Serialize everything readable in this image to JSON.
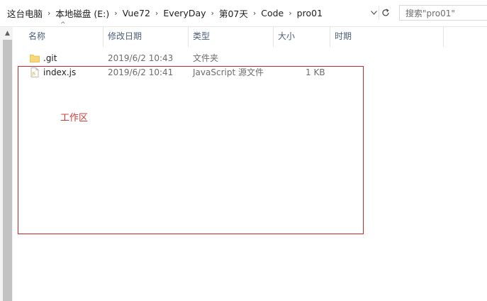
{
  "breadcrumb": {
    "items": [
      "这台电脑",
      "本地磁盘 (E:)",
      "Vue72",
      "EveryDay",
      "第07天",
      "Code",
      "pro01"
    ],
    "separator": "›"
  },
  "search": {
    "placeholder": "搜索\"pro01\""
  },
  "columns": [
    {
      "key": "name",
      "label": "名称"
    },
    {
      "key": "modified",
      "label": "修改日期"
    },
    {
      "key": "type",
      "label": "类型"
    },
    {
      "key": "size",
      "label": "大小"
    },
    {
      "key": "time",
      "label": "时期"
    }
  ],
  "files": [
    {
      "icon": "folder-icon",
      "name": ".git",
      "modified": "2019/6/2 10:43",
      "type": "文件夹",
      "size": ""
    },
    {
      "icon": "js-file-icon",
      "name": "index.js",
      "modified": "2019/6/2 10:41",
      "type": "JavaScript 源文件",
      "size": "1 KB"
    }
  ],
  "annotation": {
    "label": "工作区",
    "color": "#c1272d"
  },
  "colors": {
    "header_text": "#4c607a",
    "folder": "#f8d775"
  }
}
